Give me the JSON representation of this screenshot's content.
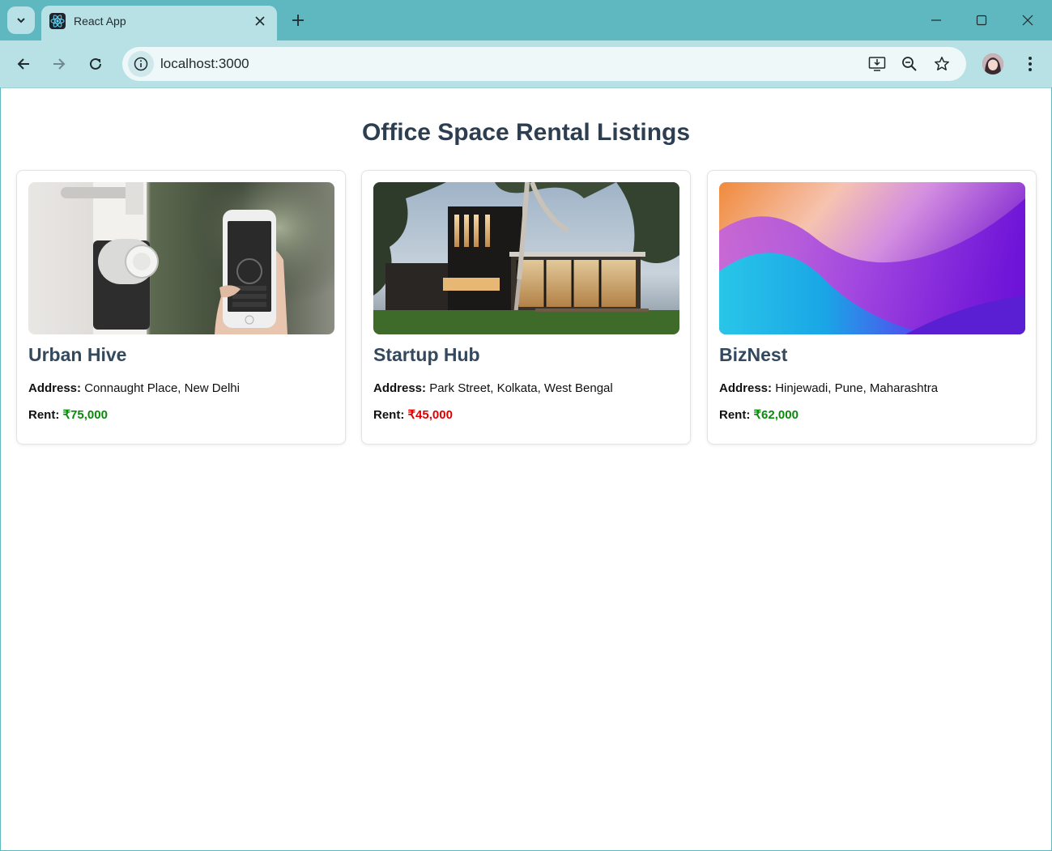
{
  "browser": {
    "tab_title": "React App",
    "url": "localhost:3000"
  },
  "page": {
    "title": "Office Space Rental Listings"
  },
  "listings": [
    {
      "name": "Urban Hive",
      "address_label": "Address:",
      "address": "Connaught Place, New Delhi",
      "rent_label": "Rent:",
      "rent": "₹75,000",
      "rent_color": "#0a8a0a"
    },
    {
      "name": "Startup Hub",
      "address_label": "Address:",
      "address": "Park Street, Kolkata, West Bengal",
      "rent_label": "Rent:",
      "rent": "₹45,000",
      "rent_color": "#e00000"
    },
    {
      "name": "BizNest",
      "address_label": "Address:",
      "address": "Hinjewadi, Pune, Maharashtra",
      "rent_label": "Rent:",
      "rent": "₹62,000",
      "rent_color": "#0a8a0a"
    }
  ],
  "icons": {
    "tab_menu": "chevron-down-icon",
    "favicon": "react-logo-icon",
    "tab_close": "close-icon",
    "new_tab": "plus-icon",
    "minimize": "minimize-icon",
    "maximize": "maximize-icon",
    "window_close": "close-icon",
    "back": "arrow-left-icon",
    "forward": "arrow-right-icon",
    "reload": "reload-icon",
    "site_info": "info-icon",
    "install": "install-app-icon",
    "zoom": "zoom-out-icon",
    "bookmark": "star-icon",
    "profile": "avatar",
    "menu": "kebab-menu-icon"
  },
  "colors": {
    "chrome_frame": "#5fb8c0",
    "chrome_toolbar": "#b8e1e6",
    "title_text": "#2c3e50",
    "card_name": "#34495e"
  }
}
